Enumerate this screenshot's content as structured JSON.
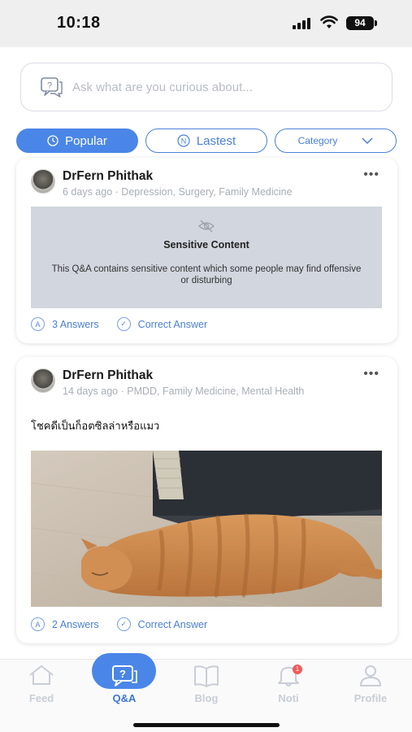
{
  "status_bar": {
    "time": "10:18",
    "battery": "94"
  },
  "search": {
    "placeholder": "Ask what are you curious about..."
  },
  "filters": {
    "popular": "Popular",
    "latest": "Lastest",
    "category": "Category"
  },
  "posts": [
    {
      "author": "DrFern Phithak",
      "time": "6 days ago",
      "tags": "Depression, Surgery, Family Medicine",
      "sensitive_title": "Sensitive Content",
      "sensitive_body": "This Q&A contains sensitive content which some people may find offensive or disturbing",
      "answers": "3 Answers",
      "correct": "Correct Answer"
    },
    {
      "author": "DrFern Phithak",
      "time": "14 days ago",
      "tags": "PMDD, Family Medicine, Mental Health",
      "question": "โชคดีเป็นก็อตซิลล่าหรือแมว",
      "answers": "2 Answers",
      "correct": "Correct Answer"
    }
  ],
  "nav": {
    "feed": "Feed",
    "qa": "Q&A",
    "blog": "Blog",
    "noti": "Noti",
    "profile": "Profile",
    "noti_badge": "1"
  },
  "colors": {
    "accent": "#4a86e8",
    "sensitive_bg": "#d1d6df",
    "muted": "#a9adb6"
  },
  "icons": [
    "signal-icon",
    "wifi-icon",
    "question-bubble-icon",
    "clock-icon",
    "new-icon",
    "chevron-down-icon",
    "more-icon",
    "eye-off-icon",
    "answer-icon",
    "check-icon",
    "home-icon",
    "qa-icon",
    "book-icon",
    "bell-icon",
    "profile-icon"
  ]
}
